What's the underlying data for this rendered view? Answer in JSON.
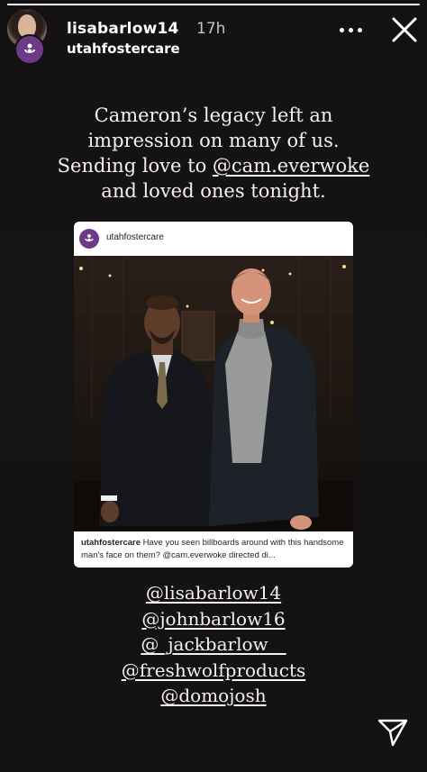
{
  "header": {
    "username": "lisabarlow14",
    "timestamp": "17h",
    "source_account": "utahfostercare"
  },
  "progress": {
    "fraction": 1.0
  },
  "caption": {
    "line1": "Cameron’s legacy left an",
    "line2": "impression on many of us.",
    "line3_prefix": "Sending love to ",
    "line3_mention": "@cam.everwoke",
    "line4": "and loved ones tonight."
  },
  "shared_post": {
    "username": "utahfostercare",
    "caption_user": "utahfostercare",
    "caption_text": " Have you seen billboards around with this handsome man's face on them? @cam.everwoke directed di..."
  },
  "mentions": [
    "@lisabarlow14",
    "@johnbarlow16",
    "@_jackbarlow__",
    "@freshwolfproducts",
    "@domojosh"
  ],
  "colors": {
    "background": "#121011",
    "brand_purple": "#6b3b87"
  },
  "icons": {
    "more": "more-icon",
    "close": "close-icon",
    "send": "send-icon"
  }
}
